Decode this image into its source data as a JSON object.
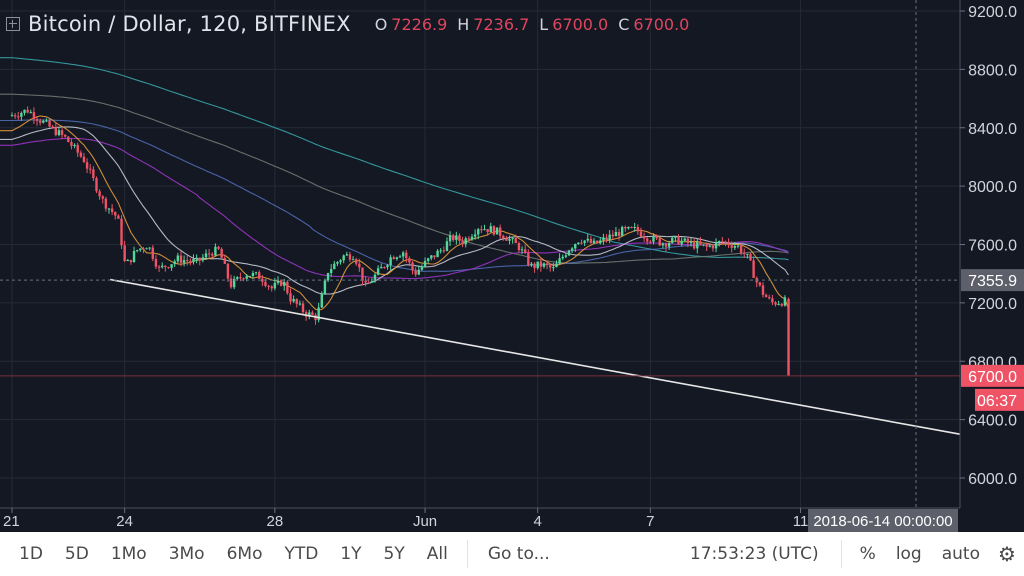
{
  "header": {
    "expand_icon": "plus-square-icon",
    "title": "Bitcoin / Dollar, 120, BITFINEX",
    "ohlc": [
      {
        "key": "O",
        "value": "7226.9"
      },
      {
        "key": "H",
        "value": "7236.7"
      },
      {
        "key": "L",
        "value": "6700.0"
      },
      {
        "key": "C",
        "value": "6700.0"
      }
    ]
  },
  "price_axis": {
    "ticks": [
      "9200.0",
      "8800.0",
      "8400.0",
      "8000.0",
      "7600.0",
      "7200.0",
      "6800.0",
      "6400.0",
      "6000.0"
    ],
    "crosshair_label": "7355.9",
    "last_price_label": "6700.0",
    "countdown_label": "06:37"
  },
  "time_axis": {
    "ticks": [
      "21",
      "24",
      "28",
      "Jun",
      "4",
      "7",
      "11"
    ],
    "crosshair_label": "2018-06-14 00:00:00"
  },
  "bottom_bar": {
    "ranges": [
      "1D",
      "5D",
      "1Mo",
      "3Mo",
      "6Mo",
      "YTD",
      "1Y",
      "5Y",
      "All"
    ],
    "goto_label": "Go to...",
    "clock": "17:53:23 (UTC)",
    "percent_label": "%",
    "log_label": "log",
    "auto_label": "auto",
    "settings_icon": "gear-icon"
  },
  "colors": {
    "up": "#26a69a",
    "up_light": "#53d89c",
    "down": "#ef5366",
    "background": "#131823",
    "grid": "#252a37",
    "ma_teal": "#38a3a8",
    "ma_gray": "#6f7b72",
    "ma_blue": "#4f6bb5",
    "ma_purple": "#9c36c6",
    "ma_white": "#c8cbd6",
    "ma_orange": "#e79a3b",
    "trendline": "#e6e6e6",
    "last_price_badge": "#ef5366",
    "crosshair_badge": "#5d606b"
  },
  "chart_data": {
    "type": "candlestick",
    "title": "Bitcoin / Dollar, 120, BITFINEX",
    "interval": "120 minutes",
    "xlabel": "",
    "ylabel": "",
    "ylim": [
      5900,
      9250
    ],
    "x_ticks": [
      "21",
      "24",
      "28",
      "Jun",
      "4",
      "7",
      "11"
    ],
    "y_ticks": [
      6000,
      6400,
      6800,
      7200,
      7600,
      8000,
      8400,
      8800,
      9200
    ],
    "grid": true,
    "last_ohlc": {
      "open": 7226.9,
      "high": 7236.7,
      "low": 6700.0,
      "close": 6700.0
    },
    "crosshair_price": 7355.9,
    "crosshair_time": "2018-06-14 00:00:00",
    "approx_close_path": [
      {
        "date": "May 21",
        "close": 8480
      },
      {
        "date": "May 22",
        "close": 8350
      },
      {
        "date": "May 23",
        "close": 7950
      },
      {
        "date": "May 24",
        "close": 7550
      },
      {
        "date": "May 25",
        "close": 7500
      },
      {
        "date": "May 26",
        "close": 7480
      },
      {
        "date": "May 27",
        "close": 7300
      },
      {
        "date": "May 28",
        "close": 7300
      },
      {
        "date": "May 29",
        "close": 7150
      },
      {
        "date": "May 30",
        "close": 7450
      },
      {
        "date": "May 31",
        "close": 7500
      },
      {
        "date": "Jun 1",
        "close": 7500
      },
      {
        "date": "Jun 2",
        "close": 7600
      },
      {
        "date": "Jun 3",
        "close": 7700
      },
      {
        "date": "Jun 4",
        "close": 7550
      },
      {
        "date": "Jun 5",
        "close": 7450
      },
      {
        "date": "Jun 6",
        "close": 7650
      },
      {
        "date": "Jun 7",
        "close": 7700
      },
      {
        "date": "Jun 8",
        "close": 7630
      },
      {
        "date": "Jun 9",
        "close": 7620
      },
      {
        "date": "Jun 10",
        "close": 7200
      },
      {
        "date": "Jun 10 (last bar)",
        "close": 6700
      }
    ],
    "trendline": {
      "from": {
        "date": "May 23.9",
        "price": 7360
      },
      "to": {
        "date": "Jun 14",
        "price": 6280
      }
    },
    "moving_averages": [
      {
        "name": "MA teal (longest)",
        "color": "#38a3a8",
        "start": 8870,
        "end": 7640
      },
      {
        "name": "MA gray",
        "color": "#6f7b72",
        "start": 8620,
        "end": 7610
      },
      {
        "name": "MA purple",
        "color": "#9c36c6",
        "start": 8280,
        "end": 7580
      },
      {
        "name": "MA blue",
        "color": "#4f6bb5",
        "start": 8450,
        "end": 7500
      },
      {
        "name": "MA white",
        "color": "#c8cbd6",
        "start": 8300,
        "end": 7360
      },
      {
        "name": "MA orange",
        "color": "#e79a3b",
        "start": 8350,
        "end": 7230
      }
    ]
  }
}
